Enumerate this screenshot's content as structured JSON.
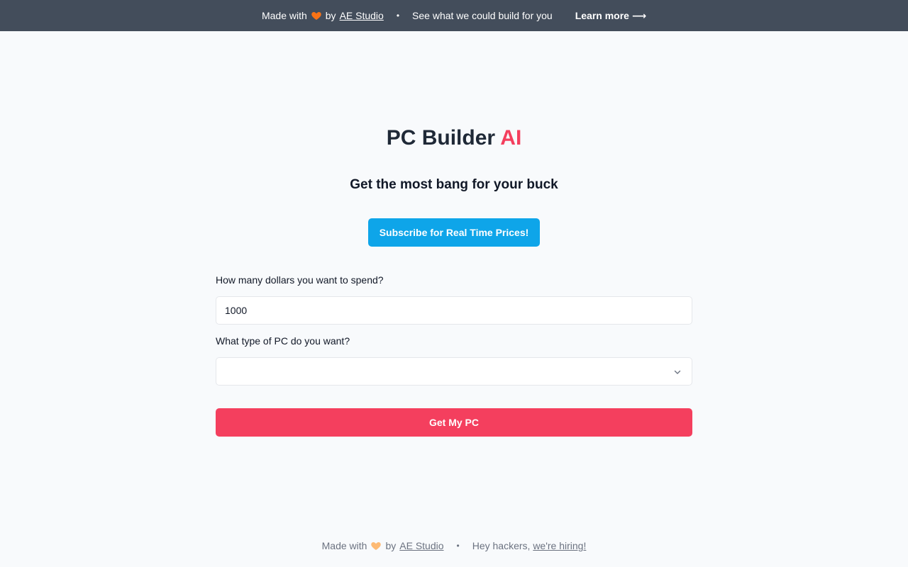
{
  "banner": {
    "made_with": "Made with",
    "by": "by",
    "studio_link": "AE Studio",
    "separator": "•",
    "pitch": "See what we could build for you",
    "learn_more": "Learn more",
    "arrow": "⟶"
  },
  "hero": {
    "title_main": "PC Builder",
    "title_accent": "AI",
    "subtitle": "Get the most bang for your buck",
    "subscribe_label": "Subscribe for Real Time Prices!"
  },
  "form": {
    "budget_label": "How many dollars you want to spend?",
    "budget_value": "1000",
    "type_label": "What type of PC do you want?",
    "type_value": "",
    "submit_label": "Get My PC"
  },
  "footer": {
    "made_with": "Made with",
    "by": "by",
    "studio_link": "AE Studio",
    "separator": "•",
    "hiring_prefix": "Hey hackers,",
    "hiring_link": "we're hiring!"
  },
  "colors": {
    "banner_bg": "#434d5b",
    "accent": "#f43f5e",
    "subscribe": "#0ea5e9",
    "heart_banner": "#f97316",
    "heart_footer": "#fdba74"
  },
  "icons": {
    "heart": "heart-icon",
    "chevron": "chevron-down-icon"
  }
}
